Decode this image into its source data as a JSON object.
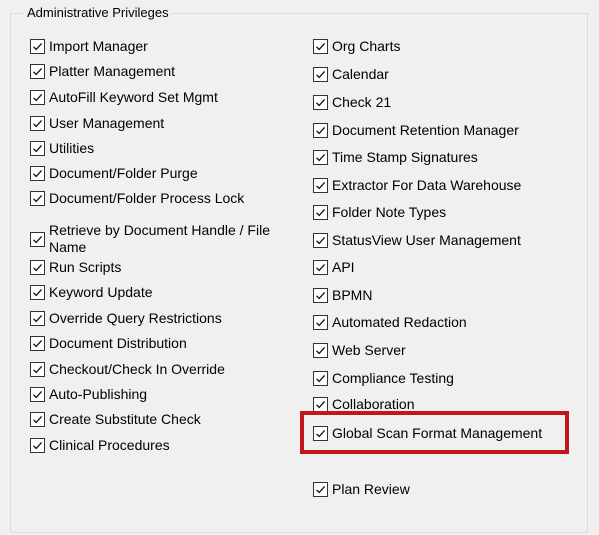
{
  "group": {
    "legend": "Administrative Privileges"
  },
  "left_column": [
    {
      "label": "Import Manager",
      "checked": true
    },
    {
      "label": "Platter Management",
      "checked": true
    },
    {
      "label": "AutoFill Keyword Set Mgmt",
      "checked": true
    },
    {
      "label": "User Management",
      "checked": true
    },
    {
      "label": "Utilities",
      "checked": true
    },
    {
      "label": "Document/Folder Purge",
      "checked": true
    },
    {
      "label": "Document/Folder Process Lock",
      "checked": true
    },
    {
      "label": "Retrieve by Document Handle / File Name",
      "checked": true
    },
    {
      "label": "Run Scripts",
      "checked": true
    },
    {
      "label": "Keyword Update",
      "checked": true
    },
    {
      "label": "Override Query Restrictions",
      "checked": true
    },
    {
      "label": "Document Distribution",
      "checked": true
    },
    {
      "label": "Checkout/Check In Override",
      "checked": true
    },
    {
      "label": "Auto-Publishing",
      "checked": true
    },
    {
      "label": "Create Substitute Check",
      "checked": true
    },
    {
      "label": "Clinical Procedures",
      "checked": true
    }
  ],
  "right_column": [
    {
      "label": "Org Charts",
      "checked": true
    },
    {
      "label": "Calendar",
      "checked": true
    },
    {
      "label": "Check 21",
      "checked": true
    },
    {
      "label": "Document Retention Manager",
      "checked": true
    },
    {
      "label": "Time Stamp Signatures",
      "checked": true
    },
    {
      "label": "Extractor For Data Warehouse",
      "checked": true
    },
    {
      "label": "Folder Note Types",
      "checked": true
    },
    {
      "label": "StatusView User Management",
      "checked": true
    },
    {
      "label": "API",
      "checked": true
    },
    {
      "label": "BPMN",
      "checked": true
    },
    {
      "label": "Automated Redaction",
      "checked": true
    },
    {
      "label": "Web Server",
      "checked": true
    },
    {
      "label": "Compliance Testing",
      "checked": true
    },
    {
      "label": "Collaboration",
      "checked": true
    },
    {
      "label": "Global Scan Format Management",
      "checked": true
    },
    {
      "label": "Plan Review",
      "checked": true
    }
  ],
  "highlight_color": "#c0161c"
}
